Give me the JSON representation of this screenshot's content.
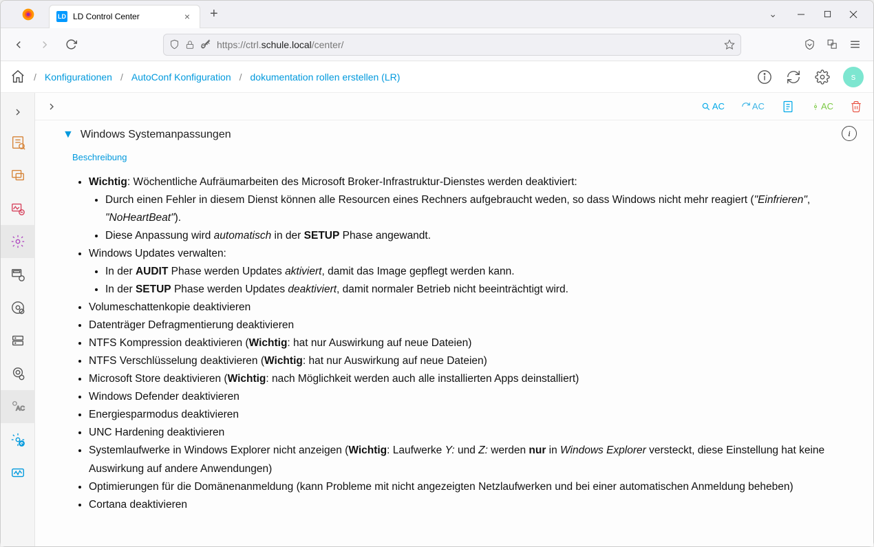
{
  "tab": {
    "favicon_text": "LD",
    "title": "LD Control Center"
  },
  "url": {
    "protocol": "https://",
    "host_prefix": "ctrl.",
    "host_strong": "schule.local",
    "path": "/center/"
  },
  "breadcrumb": {
    "items": [
      "Konfigurationen",
      "AutoConf Konfiguration",
      "dokumentation rollen erstellen (LR)"
    ]
  },
  "avatar_letter": "s",
  "toolbar_badges": {
    "ac1": "AC",
    "ac2": "AC",
    "ac3": "AC"
  },
  "section": {
    "title": "Windows Systemanpassungen",
    "desc_label": "Beschreibung"
  },
  "bullets": {
    "b1_pre": "Wichtig",
    "b1_post": ": Wöchentliche Aufräumarbeiten des Microsoft Broker-Infrastruktur-Dienstes werden deaktiviert:",
    "b1a_pre": "Durch einen Fehler in diesem Dienst können alle Resourcen eines Rechners aufgebraucht weden, so dass Windows nicht mehr reagiert (",
    "b1a_i1": "\"Einfrieren\"",
    "b1a_mid": ", ",
    "b1a_i2": "\"NoHeartBeat\"",
    "b1a_post": ").",
    "b1b_pre": "Diese Anpassung wird ",
    "b1b_i": "automatisch",
    "b1b_mid": " in der ",
    "b1b_b": "SETUP",
    "b1b_post": " Phase angewandt.",
    "b2": "Windows Updates verwalten:",
    "b2a_pre": "In der ",
    "b2a_b": "AUDIT",
    "b2a_mid": " Phase werden Updates ",
    "b2a_i": "aktiviert",
    "b2a_post": ", damit das Image gepflegt werden kann.",
    "b2b_pre": "In der ",
    "b2b_b": "SETUP",
    "b2b_mid": " Phase werden Updates ",
    "b2b_i": "deaktiviert",
    "b2b_post": ", damit normaler Betrieb nicht beeinträchtigt wird.",
    "b3": "Volumeschattenkopie deaktivieren",
    "b4": "Datenträger Defragmentierung deaktivieren",
    "b5_pre": "NTFS Kompression deaktivieren (",
    "b5_b": "Wichtig",
    "b5_post": ": hat nur Auswirkung auf neue Dateien)",
    "b6_pre": "NTFS Verschlüsselung deaktivieren (",
    "b6_b": "Wichtig",
    "b6_post": ": hat nur Auswirkung auf neue Dateien)",
    "b7_pre": "Microsoft Store deaktivieren (",
    "b7_b": "Wichtig",
    "b7_post": ": nach Möglichkeit werden auch alle installierten Apps deinstalliert)",
    "b8": "Windows Defender deaktivieren",
    "b9": "Energiesparmodus deaktivieren",
    "b10": "UNC Hardening deaktivieren",
    "b11_pre": "Systemlaufwerke in Windows Explorer nicht anzeigen (",
    "b11_b": "Wichtig",
    "b11_mid": ": Laufwerke ",
    "b11_i1": "Y:",
    "b11_mid2": " und ",
    "b11_i2": "Z:",
    "b11_mid3": " werden ",
    "b11_b2": "nur",
    "b11_mid4": " in ",
    "b11_i3": "Windows Explorer",
    "b11_post": " versteckt, diese Einstellung hat keine Auswirkung auf andere Anwendungen)",
    "b12": "Optimierungen für die Domänenanmeldung (kann Probleme mit nicht angezeigten Netzlaufwerken und bei einer automatischen Anmeldung beheben)",
    "b13": "Cortana deaktivieren"
  }
}
